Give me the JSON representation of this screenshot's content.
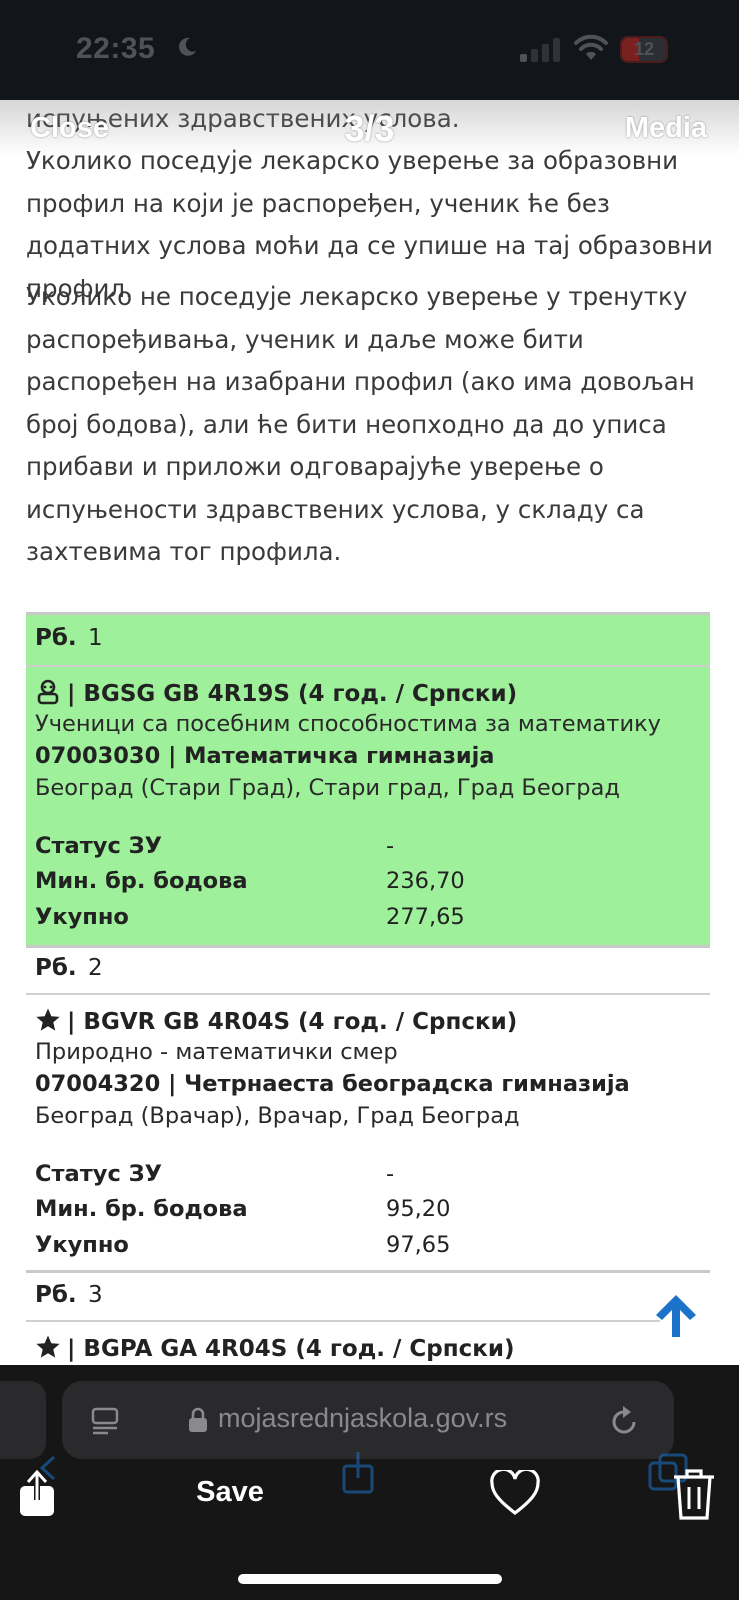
{
  "status_bar": {
    "time": "22:35",
    "battery": "12",
    "battery_level_percent": 12
  },
  "viewer": {
    "close_label": "Close",
    "counter": "3/3",
    "media_label": "Media",
    "save_label": "Save"
  },
  "page": {
    "paragraphs": [
      "испуњених здравствених услова.",
      "Уколико поседује лекарско уверење за образовни профил на који је распоређен, ученик ће без додатних услова моћи да се упише на тај образовни профил.",
      "Уколико не поседује лекарско уверење у тренутку распоређивања, ученик и даље може бити распоређен на изабрани профил (ако има довољан број бодова), али ће бити неопходно да до уписа прибави и приложи одговарајуће уверење о испуњености здравствених услова, у складу са захтевима тог профила."
    ],
    "entries": [
      {
        "rb_label": "Рб.",
        "rb": "1",
        "title": "| BGSG GB 4R19S (4 год. / Српски)",
        "subtitle": "Ученици са посебним способностима за математику",
        "code": "07003030 | Математичка гимназија",
        "location": "Београд (Стари Град), Стари град, Град Београд",
        "status_key": "Статус ЗУ",
        "status_val": "-",
        "min_key": "Мин. бр. бодова",
        "min_val": "236,70",
        "total_key": "Укупно",
        "total_val": "277,65",
        "icon": "special-student-icon",
        "highlight": "#9ef09a"
      },
      {
        "rb_label": "Рб.",
        "rb": "2",
        "title": "| BGVR GB 4R04S (4 год. / Српски)",
        "subtitle": "Природно - математички смер",
        "code": "07004320 | Четрнаеста београдска гимназија",
        "location": "Београд (Врачар), Врачар, Град Београд",
        "status_key": "Статус ЗУ",
        "status_val": "-",
        "min_key": "Мин. бр. бодова",
        "min_val": "95,20",
        "total_key": "Укупно",
        "total_val": "97,65",
        "icon": "star-icon"
      },
      {
        "rb_label": "Рб.",
        "rb": "3",
        "title": "| BGPA GA 4R04S (4 год. / Српски)",
        "icon": "star-icon"
      }
    ]
  },
  "browser": {
    "url": "mojasrednjaskola.gov.rs"
  },
  "colors": {
    "highlight_green": "#9ef09a",
    "scroll_arrow": "#1a73c9"
  }
}
